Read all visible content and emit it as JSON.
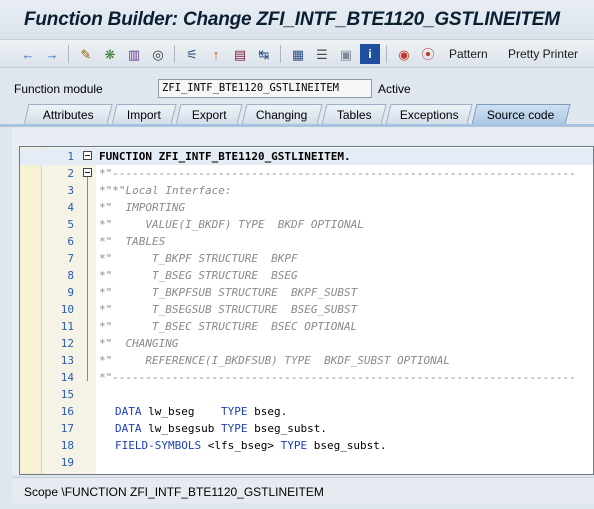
{
  "window": {
    "title": "Function Builder: Change ZFI_INTF_BTE1120_GSTLINEITEM"
  },
  "toolbar": {
    "icons": [
      "back-icon",
      "forward-icon",
      "pen-icon",
      "object-icon",
      "tree-icon",
      "activate-icon",
      "hierarchy-icon",
      "pin-icon",
      "display-icon",
      "navigate-icon",
      "structure-icon",
      "stack-icon",
      "table-icon",
      "info-icon",
      "breakpoint-icon",
      "external-breakpoint-icon"
    ],
    "pattern_label": "Pattern",
    "pretty_printer_label": "Pretty Printer"
  },
  "function_module": {
    "label": "Function module",
    "value": "ZFI_INTF_BTE1120_GSTLINEITEM",
    "status": "Active"
  },
  "tabs": [
    {
      "label": "Attributes"
    },
    {
      "label": "Import"
    },
    {
      "label": "Export"
    },
    {
      "label": "Changing"
    },
    {
      "label": "Tables"
    },
    {
      "label": "Exceptions"
    },
    {
      "label": "Source code"
    }
  ],
  "editor": {
    "lines": [
      {
        "num": "1",
        "text": "FUNCTION ZFI_INTF_BTE1120_GSTLINEITEM.",
        "kind": "pl"
      },
      {
        "num": "2",
        "text": "*\"----------------------------------------------------------------------",
        "kind": "cm"
      },
      {
        "num": "3",
        "text": "*\"*\"Local Interface:",
        "kind": "cm"
      },
      {
        "num": "4",
        "text": "*\"  IMPORTING",
        "kind": "cm"
      },
      {
        "num": "5",
        "text": "*\"     VALUE(I_BKDF) TYPE  BKDF OPTIONAL",
        "kind": "cm"
      },
      {
        "num": "6",
        "text": "*\"  TABLES",
        "kind": "cm"
      },
      {
        "num": "7",
        "text": "*\"      T_BKPF STRUCTURE  BKPF",
        "kind": "cm"
      },
      {
        "num": "8",
        "text": "*\"      T_BSEG STRUCTURE  BSEG",
        "kind": "cm"
      },
      {
        "num": "9",
        "text": "*\"      T_BKPFSUB STRUCTURE  BKPF_SUBST",
        "kind": "cm"
      },
      {
        "num": "10",
        "text": "*\"      T_BSEGSUB STRUCTURE  BSEG_SUBST",
        "kind": "cm"
      },
      {
        "num": "11",
        "text": "*\"      T_BSEC STRUCTURE  BSEC OPTIONAL",
        "kind": "cm"
      },
      {
        "num": "12",
        "text": "*\"  CHANGING",
        "kind": "cm"
      },
      {
        "num": "13",
        "text": "*\"     REFERENCE(I_BKDFSUB) TYPE  BKDF_SUBST OPTIONAL",
        "kind": "cm"
      },
      {
        "num": "14",
        "text": "*\"----------------------------------------------------------------------",
        "kind": "cm"
      },
      {
        "num": "15",
        "text": "",
        "kind": "pl"
      },
      {
        "num": "16",
        "text_kw1": "DATA",
        "text_mid": " lw_bseg    ",
        "text_kw2": "TYPE",
        "text_end": " bseg.",
        "kind": "mix"
      },
      {
        "num": "17",
        "text_kw1": "DATA",
        "text_mid": " lw_bsegsub ",
        "text_kw2": "TYPE",
        "text_end": " bseg_subst.",
        "kind": "mix"
      },
      {
        "num": "18",
        "text_kw1": "FIELD-SYMBOLS",
        "text_mid": " <lfs_bseg> ",
        "text_kw2": "TYPE",
        "text_end": " bseg_subst.",
        "kind": "mix"
      },
      {
        "num": "19",
        "text": "",
        "kind": "pl"
      }
    ]
  },
  "status_bar": {
    "text": "Scope \\FUNCTION ZFI_INTF_BTE1120_GSTLINEITEM"
  }
}
